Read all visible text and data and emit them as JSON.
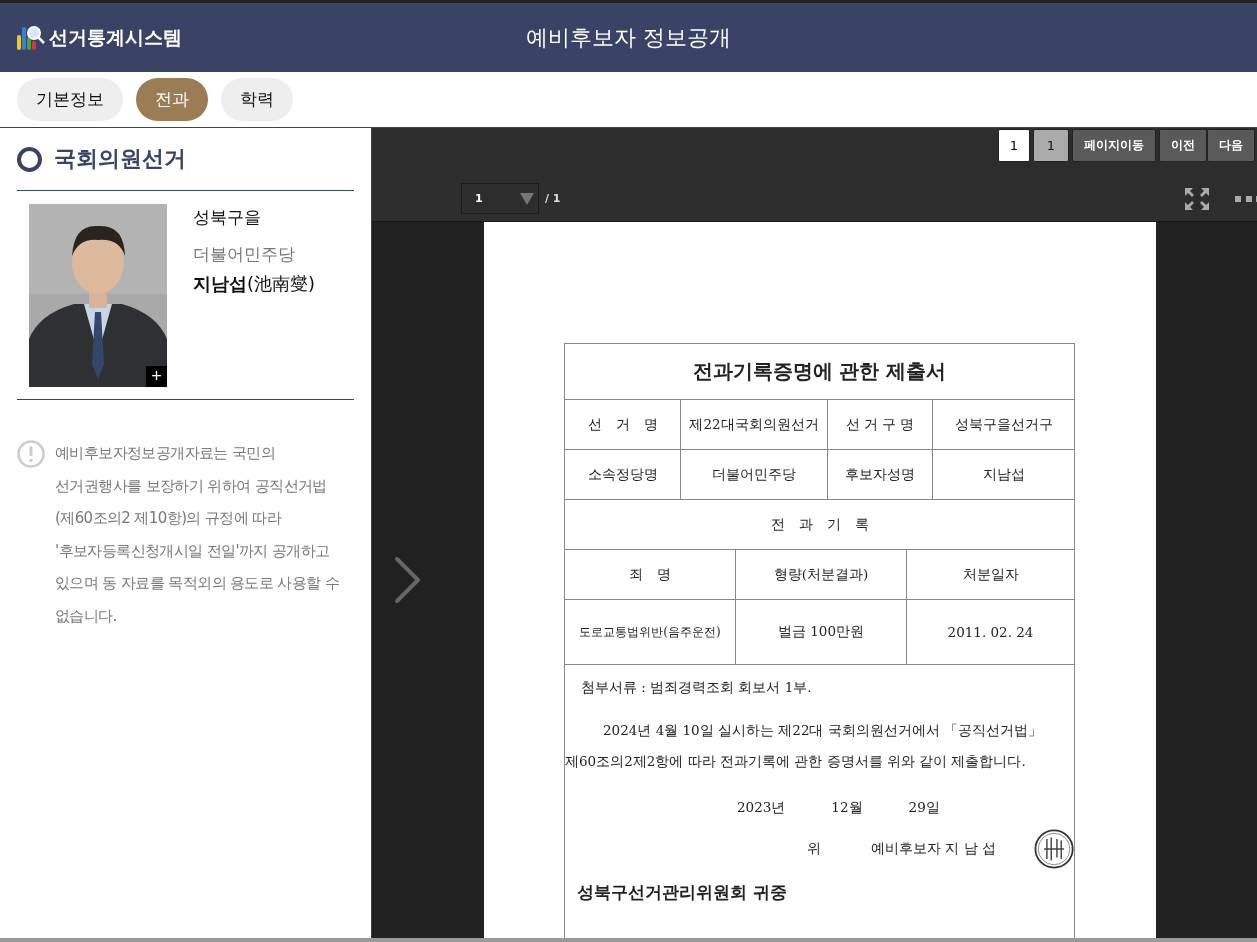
{
  "header": {
    "logo_text": "선거통계시스템",
    "title": "예비후보자 정보공개"
  },
  "tabs": [
    {
      "label": "기본정보",
      "selected": false
    },
    {
      "label": "전과",
      "selected": true
    },
    {
      "label": "학력",
      "selected": false
    }
  ],
  "candidate": {
    "election": "국회의원선거",
    "district": "성북구을",
    "party": "더불어민주당",
    "name": "**지남섭**(池南燮)",
    "zoom_button": "+"
  },
  "notice": "예비후보자정보공개자료는 국민의 선거권행사를 보장하기 위하여 공직선거법 (제60조의2 제10항)의 규정에 따라 '후보자등록신청개시일 전일'까지 공개하고 있으며 동 자료를 목적외의 용도로 사용할 수 없습니다.",
  "viewer": {
    "page_input": "1",
    "current_page": "1",
    "buttons": [
      "페이지이동",
      "이전",
      "다음"
    ],
    "page_select": "1",
    "page_total": "/ 1",
    "document": {
      "title": "전과기록증명에 관한 제출서",
      "info_rows": [
        [
          "선　거　명",
          "제22대국회의원선거",
          "선 거 구 명",
          "성북구을선거구"
        ],
        [
          "소속정당명",
          "더불어민주당",
          "후보자성명",
          "지남섭"
        ]
      ],
      "section_title": "전　과　기　록",
      "record_headers": [
        "죄　명",
        "형량(처분결과)",
        "처분일자"
      ],
      "records": [
        [
          "도로교통법위반(음주운전)",
          "벌금 100만원",
          "2011. 02. 24"
        ]
      ],
      "attachment": "첨부서류 : 범죄경력조회 회보서 1부.",
      "body": [
        "2024년 4월 10일 실시하는 제22대 국회의원선거에서 「공직선거법」",
        "제60조의2제2항에 따라 전과기록에 관한 증명서를 위와 같이 제출합니다."
      ],
      "date": [
        "2023년",
        "12월",
        "29일"
      ],
      "signature": [
        "위",
        "예비후보자 지 남 섭"
      ],
      "addressee": "성북구선거관리위원회 귀중"
    }
  }
}
